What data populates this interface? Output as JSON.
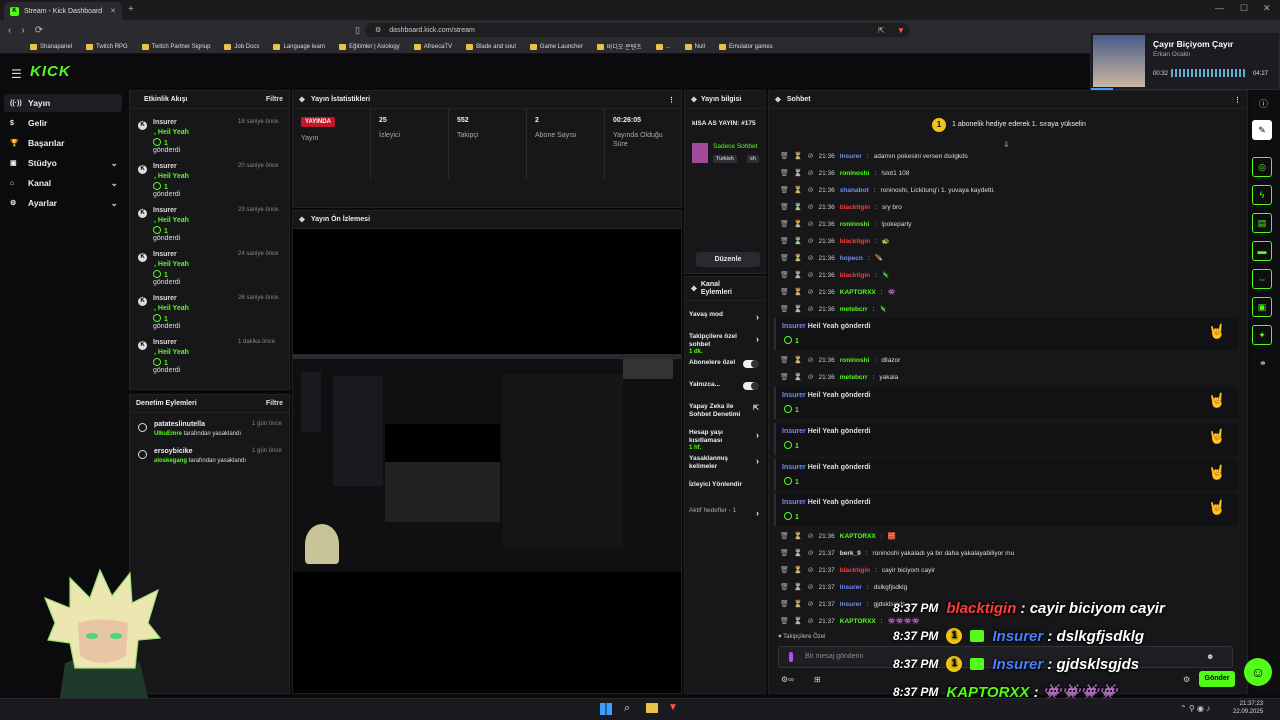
{
  "browser": {
    "tab_title": "Stream - Kick Dashboard",
    "url": "dashboard.kick.com/stream",
    "bookmarks": [
      "Shanapanel",
      "Twitch RPG",
      "Twitch Partner Signup",
      "Job Docs",
      "Language learn",
      "Eğitimler | Asiology",
      "AfreecaTV",
      "Blade and soul",
      "Game Launcher",
      "바디오 콘텐츠",
      "...",
      "Null",
      "Emulator games"
    ]
  },
  "media": {
    "title": "Çayır Biçiyom Çayır",
    "artist": "Erkan Ocaklı",
    "elapsed": "00:32",
    "duration": "04:27"
  },
  "brand": {
    "logo": "KICK",
    "accent": "#53fc18"
  },
  "sidebar": {
    "items": [
      {
        "label": "Yayın",
        "icon": "broadcast-icon",
        "has_chevron": false,
        "active": true
      },
      {
        "label": "Gelir",
        "icon": "revenue-icon",
        "has_chevron": false
      },
      {
        "label": "Başarılar",
        "icon": "trophy-icon",
        "has_chevron": false
      },
      {
        "label": "Stüdyo",
        "icon": "studio-icon",
        "has_chevron": true
      },
      {
        "label": "Kanal",
        "icon": "channel-icon",
        "has_chevron": true
      },
      {
        "label": "Ayarlar",
        "icon": "settings-icon",
        "has_chevron": true
      }
    ]
  },
  "activity": {
    "title": "Etkinlik Akışı",
    "filter": "Filtre",
    "items": [
      {
        "user": "Insurer",
        "gift": ", Heil Yeah",
        "count": "1",
        "sent": "gönderdi",
        "time": "18 saniye önce"
      },
      {
        "user": "Insurer",
        "gift": ", Heil Yeah",
        "count": "1",
        "sent": "gönderdi",
        "time": "20 saniye önce"
      },
      {
        "user": "Insurer",
        "gift": ", Heil Yeah",
        "count": "1",
        "sent": "gönderdi",
        "time": "23 saniye önce"
      },
      {
        "user": "Insurer",
        "gift": ", Heil Yeah",
        "count": "1",
        "sent": "gönderdi",
        "time": "24 saniye önce"
      },
      {
        "user": "Insurer",
        "gift": ", Heil Yeah",
        "count": "1",
        "sent": "gönderdi",
        "time": "26 saniye önce"
      },
      {
        "user": "Insurer",
        "gift": ", Heil Yeah",
        "count": "1",
        "sent": "gönderdi",
        "time": "1 dakika önce"
      }
    ]
  },
  "moderation": {
    "title": "Denetim Eylemleri",
    "filter": "Filtre",
    "items": [
      {
        "user": "patateslinutella",
        "by": "UlkuEmre",
        "action": "tarafından yasaklandı",
        "time": "1 gün önce"
      },
      {
        "user": "ersoybicike",
        "by": "aloskegang",
        "action": "tarafından yasaklandı",
        "time": "1 gün önce"
      }
    ]
  },
  "stats": {
    "title": "Yayın İstatistikleri",
    "items": [
      {
        "value": "YAYINDA",
        "label": "Yayın"
      },
      {
        "value": "25",
        "label": "İzleyici"
      },
      {
        "value": "552",
        "label": "Takipçi"
      },
      {
        "value": "2",
        "label": "Abone Sayısı"
      },
      {
        "value": "00:26:05",
        "label": "Yayında Olduğu Süre"
      }
    ]
  },
  "preview": {
    "title": "Yayın Ön İzlemesi"
  },
  "stream_info": {
    "title": "Yayın bilgisi",
    "stream_title": "kISA AS YAYIN: #175",
    "category": "Sadece Sohbet",
    "tags": [
      "Turkish",
      "sh"
    ],
    "edit": "Düzenle"
  },
  "channel_actions": {
    "title": "Kanal Eylemleri",
    "items": [
      {
        "label": "Yavaş mod",
        "type": "arrow"
      },
      {
        "label": "Takipçilere özel sohbet",
        "sub": "1 dk.",
        "type": "arrow"
      },
      {
        "label": "Abonelere özel",
        "type": "toggle"
      },
      {
        "label": "Yalnızca...",
        "type": "toggle"
      },
      {
        "label": "Yapay Zeka ile Sohbet Denetimi",
        "type": "ext"
      },
      {
        "label": "Hesap yaşı kısıtlaması",
        "sub": "1 hf.",
        "type": "arrow"
      },
      {
        "label": "Yasaklanmış kelimeler",
        "type": "arrow"
      },
      {
        "label": "İzleyici Yönlendir",
        "type": "none"
      },
      {
        "label": "Aktif hedefler - 1",
        "type": "arrow"
      }
    ]
  },
  "chat": {
    "title": "Sohbet",
    "pinned": "1 abonelik hediye ederek 1. sıraya yükselin",
    "messages": [
      {
        "time": "21:36",
        "user": "Insurer",
        "color": "#6e8cff",
        "text": "adamın pokesini versen dsılgkds"
      },
      {
        "time": "21:36",
        "user": "roninoshi",
        "color": "#53fc18",
        "text": "!slot1 108"
      },
      {
        "time": "21:36",
        "user": "shanabot",
        "color": "#6e8cff",
        "text": "roninoshi, Lickitung'ı 1. yuvaya kaydetti."
      },
      {
        "time": "21:36",
        "user": "blacktigin",
        "color": "#ff3b3b",
        "text": "sry bro"
      },
      {
        "time": "21:36",
        "user": "roninoshi",
        "color": "#53fc18",
        "text": "!pokeparty"
      },
      {
        "time": "21:36",
        "user": "blacktigin",
        "color": "#ff3b3b",
        "text": "🐢"
      },
      {
        "time": "21:36",
        "user": "hopecn",
        "color": "#6e8cff",
        "text": "🪶"
      },
      {
        "time": "21:36",
        "user": "blacktigin",
        "color": "#ff3b3b",
        "text": "🦎"
      },
      {
        "time": "21:36",
        "user": "KAPTORXX",
        "color": "#53fc18",
        "text": "👾"
      },
      {
        "time": "21:36",
        "user": "metebcrr",
        "color": "#53fc18",
        "text": "🦎"
      }
    ],
    "messages2": [
      {
        "time": "21:36",
        "user": "roninoshi",
        "color": "#53fc18",
        "text": "dllazor"
      },
      {
        "time": "21:36",
        "user": "metebcrr",
        "color": "#53fc18",
        "text": "yakala"
      }
    ],
    "messages3": [
      {
        "time": "21:36",
        "user": "KAPTORXX",
        "color": "#53fc18",
        "text": "🧱"
      },
      {
        "time": "21:37",
        "user": "berk_9",
        "color": "#dddddd",
        "text": "roninoshi yakaladı ya bir daha yakalayabiliyor mu"
      },
      {
        "time": "21:37",
        "user": "blacktigin",
        "color": "#ff3b3b",
        "text": "cayir biciyom cayir"
      },
      {
        "time": "21:37",
        "user": "Insurer",
        "color": "#6e8cff",
        "text": "dslkgfjsdklg"
      },
      {
        "time": "21:37",
        "user": "Insurer",
        "color": "#6e8cff",
        "text": "gjdsklsgjds"
      },
      {
        "time": "21:37",
        "user": "KAPTORXX",
        "color": "#53fc18",
        "text": "👾👾👾👾"
      }
    ],
    "gift_user": "Insurer",
    "gift_text": "Heil Yeah gönderdi",
    "gift_count": "1",
    "followers_only": "Takipçilere Özel",
    "input_placeholder": "Bir mesaj gönderin",
    "send": "Gönder"
  },
  "overlay": [
    {
      "time": "8:37 PM",
      "user": "blacktigin",
      "text": " : cayir biciyom cayir",
      "color": "#ff3b3b",
      "badge": false
    },
    {
      "time": "8:37 PM",
      "user": "Insurer",
      "text": " : dslkgfjsdklg",
      "color": "#4a7dff",
      "badge": true
    },
    {
      "time": "8:37 PM",
      "user": "Insurer",
      "text": " : gjdsklsgjds",
      "color": "#4a7dff",
      "badge": true
    },
    {
      "time": "8:37 PM",
      "user": "KAPTORXX",
      "text": " : 👾👾👾👾",
      "color": "#53fc18",
      "badge": false
    }
  ],
  "taskbar": {
    "time": "21:37:23",
    "date": "22.09.2025"
  }
}
